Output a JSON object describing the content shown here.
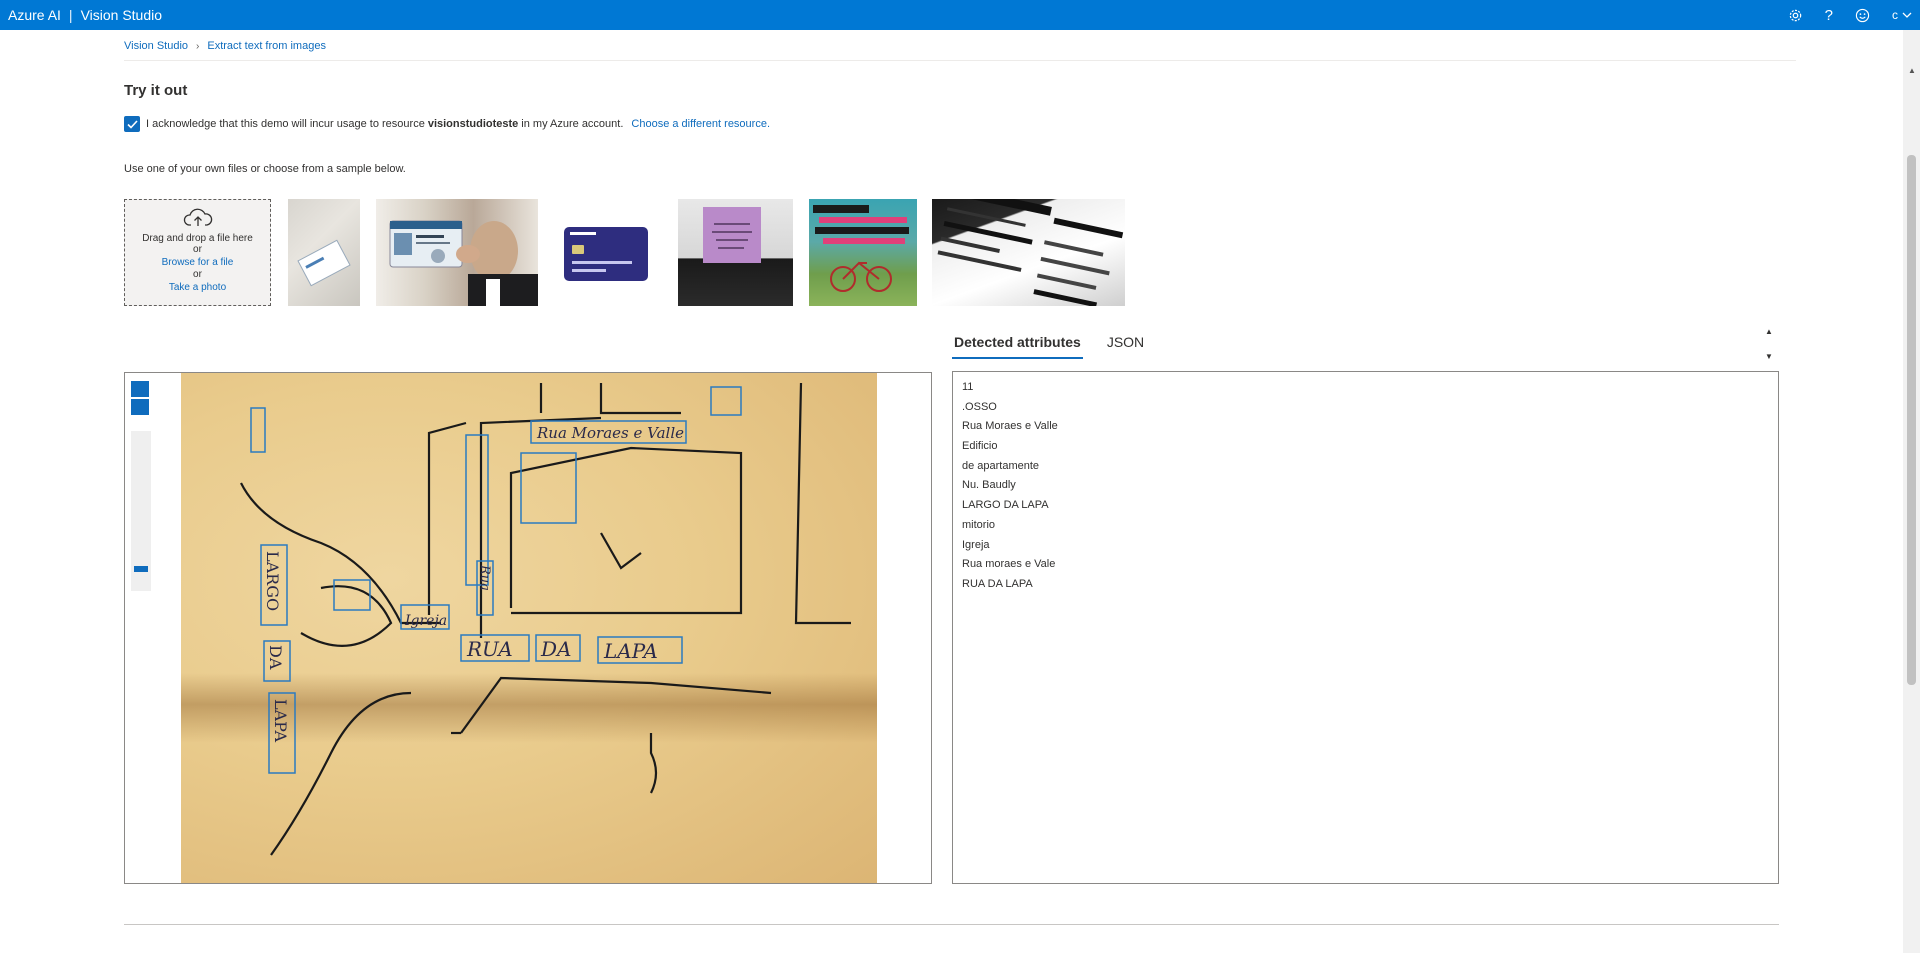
{
  "app": {
    "brand": "Azure AI",
    "product": "Vision Studio",
    "account_initial": "c"
  },
  "breadcrumb": {
    "home": "Vision Studio",
    "current": "Extract text from images"
  },
  "page": {
    "title": "Try it out",
    "ack_prefix": "I acknowledge that this demo will incur usage to resource",
    "resource_name": "visionstudioteste",
    "ack_suffix": "in my Azure account.",
    "change_resource_link": "Choose a different resource.",
    "samples_hint": "Use one of your own files or choose from a sample below."
  },
  "upload": {
    "drag_text": "Drag and drop a file here",
    "or1": "or",
    "browse": "Browse for a file",
    "or2": "or",
    "photo": "Take a photo"
  },
  "tabs": {
    "detected": "Detected attributes",
    "json": "JSON"
  },
  "results": {
    "lines": [
      "11",
      ".OSSO",
      "Rua Moraes e Valle",
      "Edificio",
      "de apartamente",
      "Nu. Baudly",
      "LARGO DA LAPA",
      "mitorio",
      "Igreja",
      "Rua moraes e Vale",
      "RUA DA LAPA"
    ]
  },
  "document": {
    "labels": [
      "Rua Moraes e Valle",
      "RUA",
      "DA",
      "LAPA",
      "LARGO",
      "DA",
      "LAPA",
      "Igreja",
      "Rua"
    ]
  },
  "colors": {
    "accent": "#0078d4",
    "link": "#0f6cbd"
  },
  "icons": {
    "settings": "gear-icon",
    "help": "help-icon",
    "feedback": "smiley-icon",
    "upload": "cloud-upload-icon"
  }
}
